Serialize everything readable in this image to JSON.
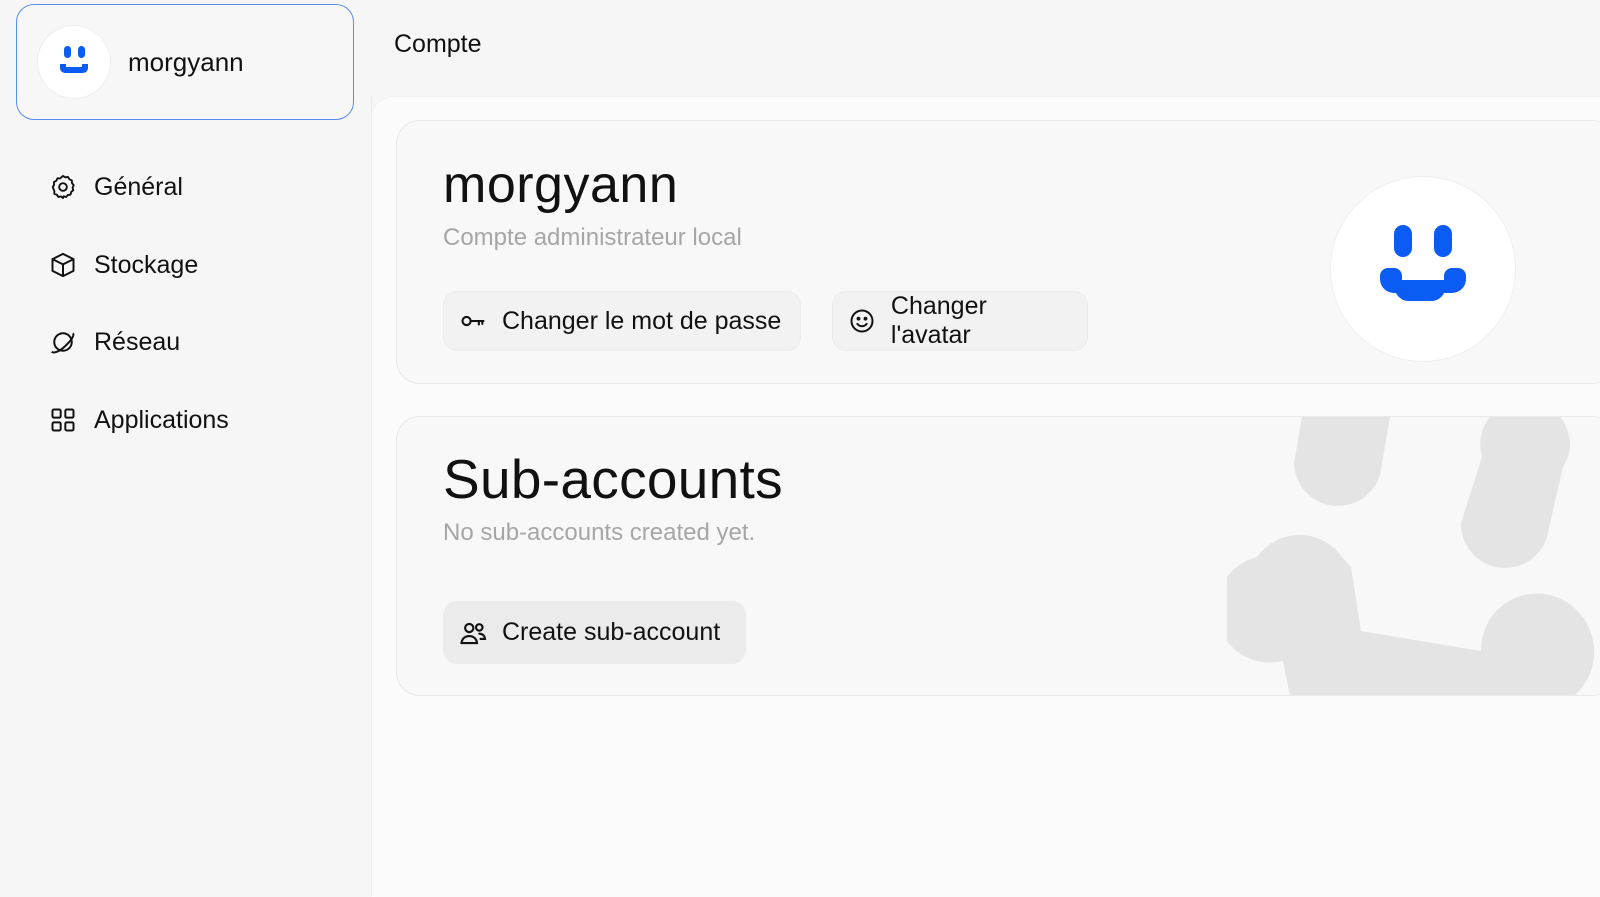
{
  "sidebar": {
    "user": {
      "name": "morgyann",
      "avatar_icon": "smiley-icon"
    },
    "items": [
      {
        "label": "Général",
        "icon": "gear-icon"
      },
      {
        "label": "Stockage",
        "icon": "box-icon"
      },
      {
        "label": "Réseau",
        "icon": "planet-icon"
      },
      {
        "label": "Applications",
        "icon": "grid-icon"
      }
    ]
  },
  "header": {
    "title": "Compte"
  },
  "account": {
    "name": "morgyann",
    "role": "Compte administrateur local",
    "change_password_label": "Changer le mot de passe",
    "change_avatar_label": "Changer l'avatar"
  },
  "subaccounts": {
    "title": "Sub-accounts",
    "empty_text": "No sub-accounts created yet.",
    "create_label": "Create sub-account"
  },
  "colors": {
    "accent": "#0a5cf5",
    "card_border_active": "#5b8cf0",
    "muted_text": "#a6a6a6"
  }
}
